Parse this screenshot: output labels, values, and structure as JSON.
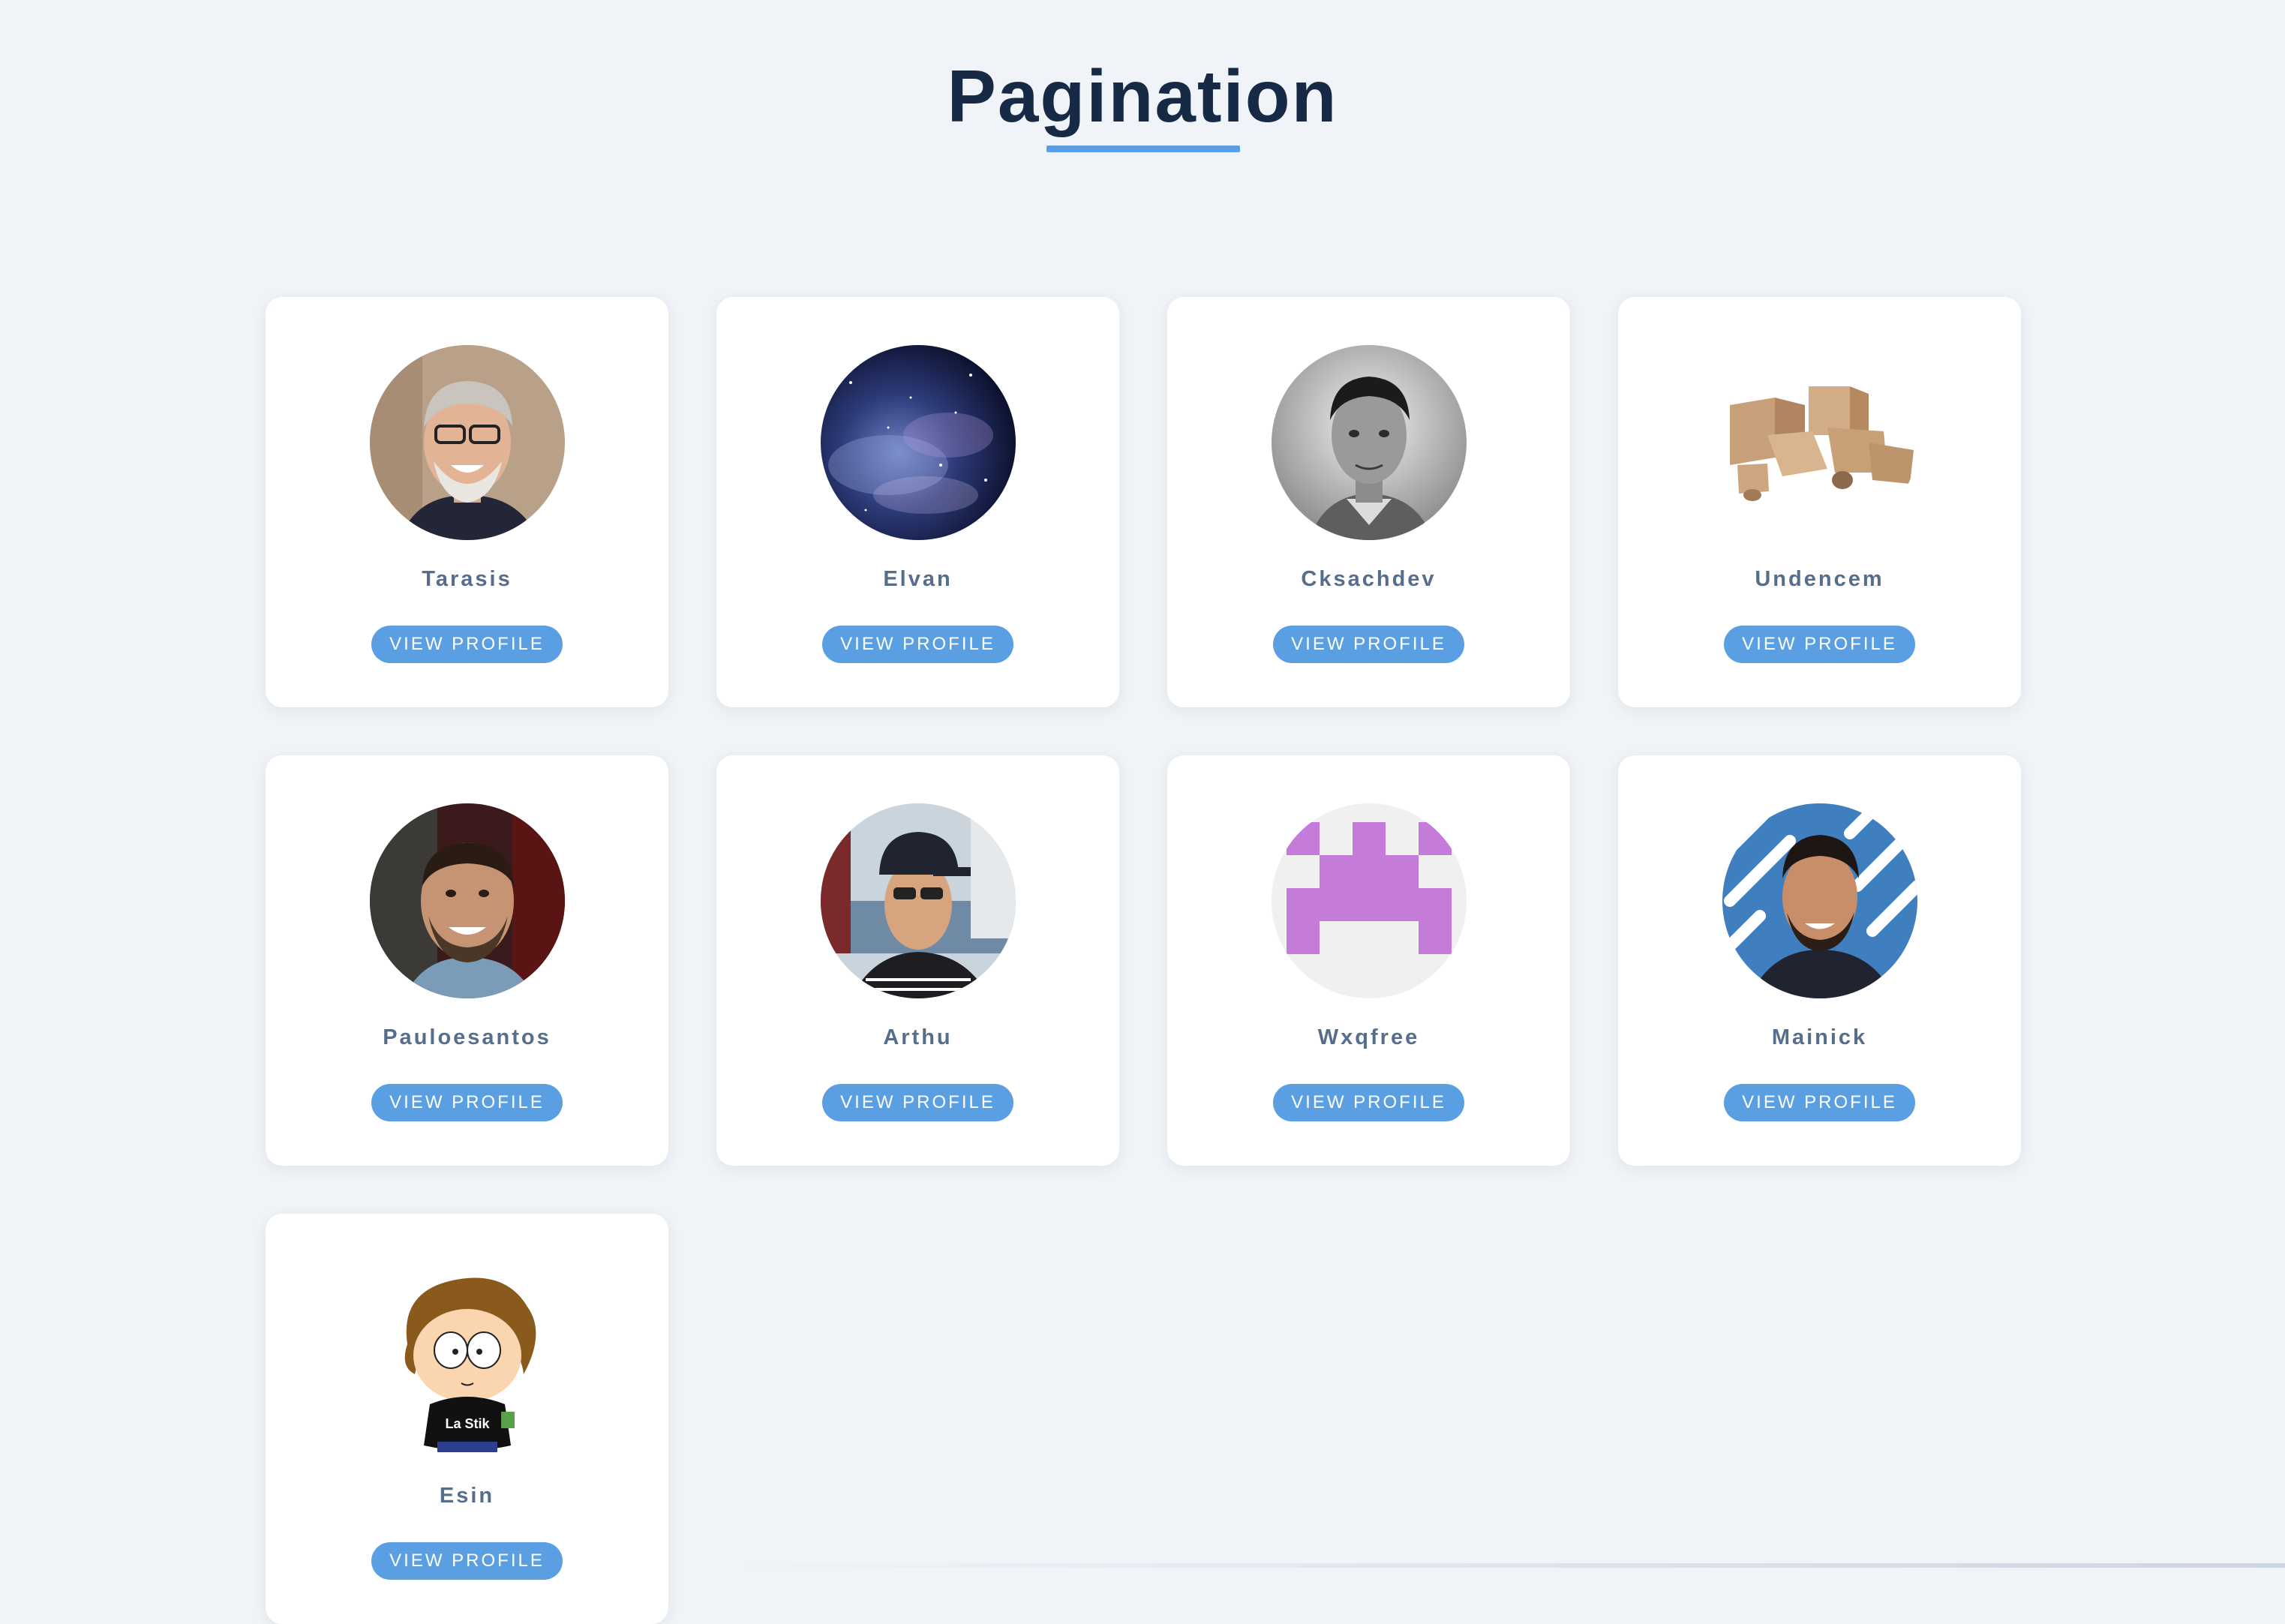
{
  "header": {
    "title": "Pagination"
  },
  "colors": {
    "background": "#f0f4f8",
    "title": "#172a45",
    "accent": "#5b9fe3",
    "name_text": "#566e8c",
    "card": "#ffffff"
  },
  "profiles": [
    {
      "name": "Tarasis",
      "button_label": "VIEW PROFILE",
      "avatar": "photo-gray-haired-man-glasses"
    },
    {
      "name": "Elvan",
      "button_label": "VIEW PROFILE",
      "avatar": "galaxy-nebula-image"
    },
    {
      "name": "Cksachdev",
      "button_label": "VIEW PROFILE",
      "avatar": "photo-man-black-and-white"
    },
    {
      "name": "Undencem",
      "button_label": "VIEW PROFILE",
      "avatar": "cardboard-boxes-image"
    },
    {
      "name": "Pauloesantos",
      "button_label": "VIEW PROFILE",
      "avatar": "photo-smiling-bearded-man"
    },
    {
      "name": "Arthu",
      "button_label": "VIEW PROFILE",
      "avatar": "photo-man-cap-sunglasses"
    },
    {
      "name": "Wxqfree",
      "button_label": "VIEW PROFILE",
      "avatar": "purple-identicon"
    },
    {
      "name": "Mainick",
      "button_label": "VIEW PROFILE",
      "avatar": "photo-man-blue-pattern"
    },
    {
      "name": "Esin",
      "button_label": "VIEW PROFILE",
      "avatar": "cartoon-character-la-stik"
    }
  ],
  "esin_shirt_text": "La Stik"
}
